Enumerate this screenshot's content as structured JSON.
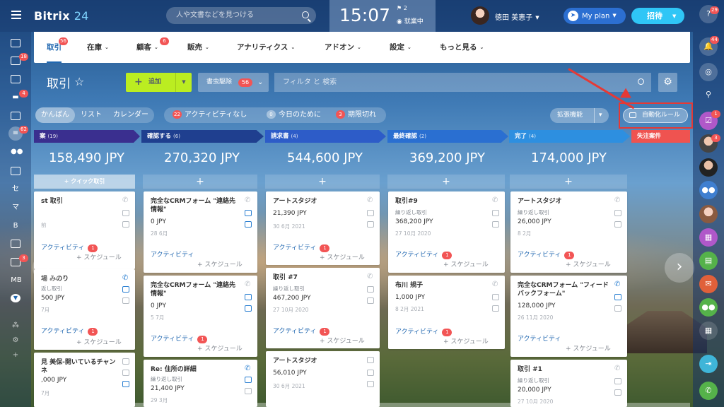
{
  "topbar": {
    "logo_main": "Bitrix",
    "logo_num": "24",
    "search_placeholder": "人や文書などを見つける",
    "clock": "15:07",
    "flag_count": "2",
    "work_status": "就業中",
    "user_name": "徳田 美恵子",
    "plan_label": "My plan",
    "invite_label": "招待"
  },
  "left_sidebar": {
    "badges": {
      "tasks": "18",
      "chat": "4",
      "crm": "62",
      "misc": "3"
    },
    "letters": [
      "セ",
      "マ",
      "B",
      "MB"
    ]
  },
  "right_sidebar": {
    "badges": {
      "top": "29",
      "notify": "44",
      "tasks": "1",
      "contact": "3"
    }
  },
  "menu": {
    "items": [
      {
        "label": "取引",
        "badge": "56"
      },
      {
        "label": "在庫"
      },
      {
        "label": "顧客",
        "badge": "6"
      },
      {
        "label": "販売"
      },
      {
        "label": "アナリティクス"
      },
      {
        "label": "アドオン"
      },
      {
        "label": "設定"
      },
      {
        "label": "もっと見る"
      }
    ]
  },
  "toolbar": {
    "title": "取引",
    "add_label": "追加",
    "duplicates_label": "書虫駆除",
    "duplicates_count": "56",
    "filter_placeholder": "フィルタ と 検索"
  },
  "views": {
    "kanban": "かんばん",
    "list": "リスト",
    "calendar": "カレンダー"
  },
  "counters": {
    "no_activity": {
      "count": "22",
      "label": "アクティビティなし"
    },
    "today": {
      "count": "0",
      "label": "今日のために"
    },
    "overdue": {
      "count": "3",
      "label": "期限切れ"
    }
  },
  "extensions_label": "拡張機能",
  "automation_label": "自動化ルール",
  "columns": [
    {
      "name": "提案",
      "count": "(19)",
      "sum": "158,490 JPY",
      "color": "#3a2f8f",
      "quick_label": "+ クイック取引"
    },
    {
      "name": "確認する",
      "count": "(6)",
      "sum": "270,320 JPY",
      "color": "#1f3f8f"
    },
    {
      "name": "請求書",
      "count": "(4)",
      "sum": "544,600 JPY",
      "color": "#2d5cc8"
    },
    {
      "name": "最終確認",
      "count": "(2)",
      "sum": "369,200 JPY",
      "color": "#2a6fd1"
    },
    {
      "name": "完了",
      "count": "(4)",
      "sum": "174,000 JPY",
      "color": "#2d8fe0"
    },
    {
      "name": "失注案件",
      "count": "",
      "sum": "",
      "color": "#ef5350"
    }
  ],
  "cards": {
    "c0a": {
      "title": "st 取引",
      "sub": "",
      "amount": "",
      "date": "前",
      "activity": "アクティビティ",
      "badge": "1",
      "schedule": "+ スケジュール"
    },
    "c0b": {
      "title": "場 みのり",
      "sub": "返し取引",
      "amount": "500 JPY",
      "date": "7月",
      "activity": "アクティビティ",
      "badge": "1",
      "schedule": "+ スケジュール"
    },
    "c0c": {
      "title": "見 美保-開いているチャンネ",
      "sub": "",
      "amount": ",000 JPY",
      "date": "7月"
    },
    "c1a": {
      "title": "完全なCRMフォーム \"連絡先情報\"",
      "amount": "0 JPY",
      "date": "28 6月",
      "activity": "アクティビティ",
      "schedule": "+ スケジュール"
    },
    "c1b": {
      "title": "完全なCRMフォーム \"連絡先情報\"",
      "amount": "0 JPY",
      "date": "5 7月",
      "activity": "アクティビティ",
      "badge": "1",
      "schedule": "+ スケジュール"
    },
    "c1c": {
      "title": "Re: 住所の詳細",
      "sub": "繰り返し取引",
      "amount": "21,400 JPY",
      "date": "29 3月"
    },
    "c2a": {
      "title": "アートスタジオ",
      "amount": "21,390 JPY",
      "date": "30 6月 2021",
      "activity": "アクティビティ",
      "badge": "1",
      "schedule": "+ スケジュール"
    },
    "c2b": {
      "title": "取引 #7",
      "sub": "繰り返し取引",
      "amount": "467,200 JPY",
      "date": "27 10月 2020",
      "activity": "アクティビティ",
      "badge": "1",
      "schedule": "+ スケジュール"
    },
    "c2c": {
      "title": "アートスタジオ",
      "amount": "56,010 JPY",
      "date": "30 6月 2021"
    },
    "c3a": {
      "title": "取引#9",
      "sub": "繰り返し取引",
      "amount": "368,200 JPY",
      "date": "27 10月 2020",
      "activity": "アクティビティ",
      "badge": "1",
      "schedule": "+ スケジュール"
    },
    "c3b": {
      "title": "布川 規子",
      "amount": "1,000 JPY",
      "date": "8 2月 2021",
      "activity": "アクティビティ",
      "badge": "1",
      "schedule": "+ スケジュール"
    },
    "c4a": {
      "title": "アートスタジオ",
      "sub": "繰り返し取引",
      "amount": "26,000 JPY",
      "date": "8 2月",
      "activity": "アクティビティ",
      "badge": "1",
      "schedule": "+ スケジュール"
    },
    "c4b": {
      "title": "完全なCRMフォーム \"フィードバックフォーム\"",
      "amount": "128,000 JPY",
      "date": "26 11月 2020",
      "activity": "アクティビティ",
      "schedule": "+ スケジュール"
    },
    "c4c": {
      "title": "取引 #1",
      "sub": "繰り返し取引",
      "amount": "20,000 JPY",
      "date": "27 10月 2020"
    }
  },
  "colors": {
    "accent": "#2067b0",
    "add_button": "#bbed21",
    "badge": "#f25555",
    "highlight": "#e53935",
    "invite": "#2fc6f6"
  }
}
